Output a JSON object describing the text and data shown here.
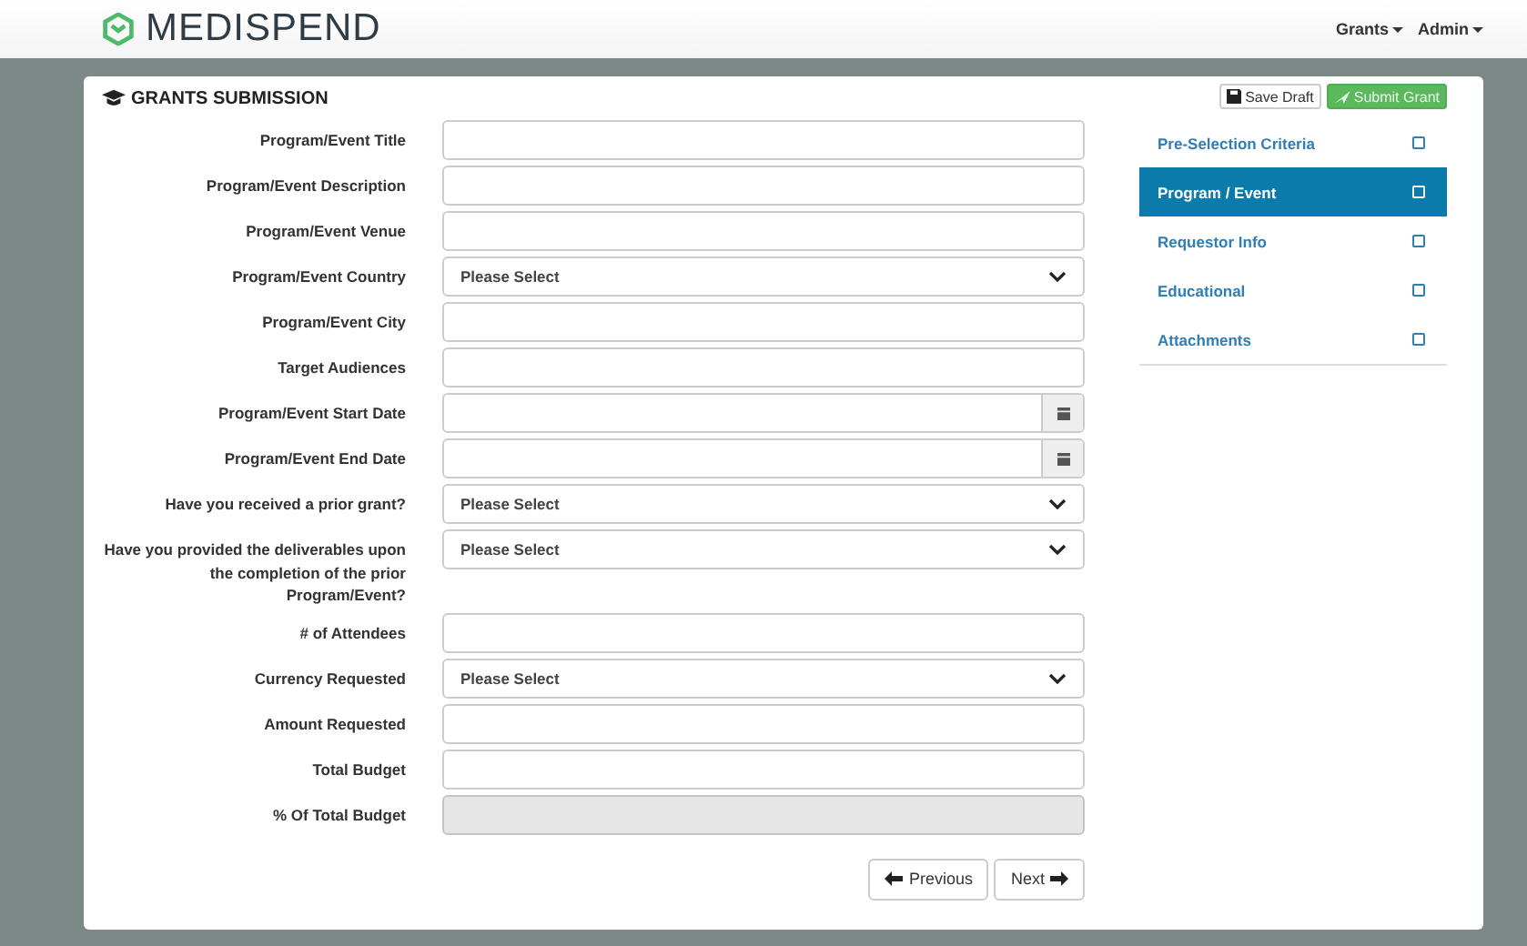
{
  "brand": "MEDISPEND",
  "nav": [
    {
      "label": "Grants"
    },
    {
      "label": "Admin"
    }
  ],
  "panel_title": "GRANTS SUBMISSION",
  "actions": [
    {
      "label": "Save Draft",
      "kind": "save"
    },
    {
      "label": "Submit Grant",
      "kind": "submit"
    }
  ],
  "fields": [
    {
      "label": "Program/Event Title",
      "kind": "text",
      "disabled": false
    },
    {
      "label": "Program/Event Description",
      "kind": "text",
      "disabled": false
    },
    {
      "label": "Program/Event Venue",
      "kind": "text",
      "disabled": false
    },
    {
      "label": "Program/Event Country",
      "kind": "select",
      "value": "Please Select",
      "disabled": false
    },
    {
      "label": "Program/Event City",
      "kind": "text",
      "disabled": false
    },
    {
      "label": "Target Audiences",
      "kind": "text",
      "disabled": false
    },
    {
      "label": "Program/Event Start Date",
      "kind": "date",
      "disabled": false
    },
    {
      "label": "Program/Event End Date",
      "kind": "date",
      "disabled": false
    },
    {
      "label": "Have you received a prior grant?",
      "kind": "select",
      "value": "Please Select",
      "disabled": false
    },
    {
      "label": "Have you provided the deliverables upon the completion of the prior Program/Event?",
      "kind": "select",
      "value": "Please Select",
      "disabled": false
    },
    {
      "label": "# of Attendees",
      "kind": "text",
      "disabled": false
    },
    {
      "label": "Currency Requested",
      "kind": "select",
      "value": "Please Select",
      "disabled": false
    },
    {
      "label": "Amount Requested",
      "kind": "text",
      "disabled": false
    },
    {
      "label": "Total Budget",
      "kind": "text",
      "disabled": false
    },
    {
      "label": "% Of Total Budget",
      "kind": "text",
      "disabled": true
    }
  ],
  "pager": [
    {
      "label": "Previous",
      "kind": "prev"
    },
    {
      "label": "Next",
      "kind": "next"
    }
  ],
  "steps": [
    {
      "label": "Pre-Selection Criteria",
      "selected": false,
      "checked": false
    },
    {
      "label": "Program / Event",
      "selected": true,
      "checked": false
    },
    {
      "label": "Requestor Info",
      "selected": false,
      "checked": false
    },
    {
      "label": "Educational",
      "selected": false,
      "checked": false
    },
    {
      "label": "Attachments",
      "selected": false,
      "checked": false
    }
  ]
}
